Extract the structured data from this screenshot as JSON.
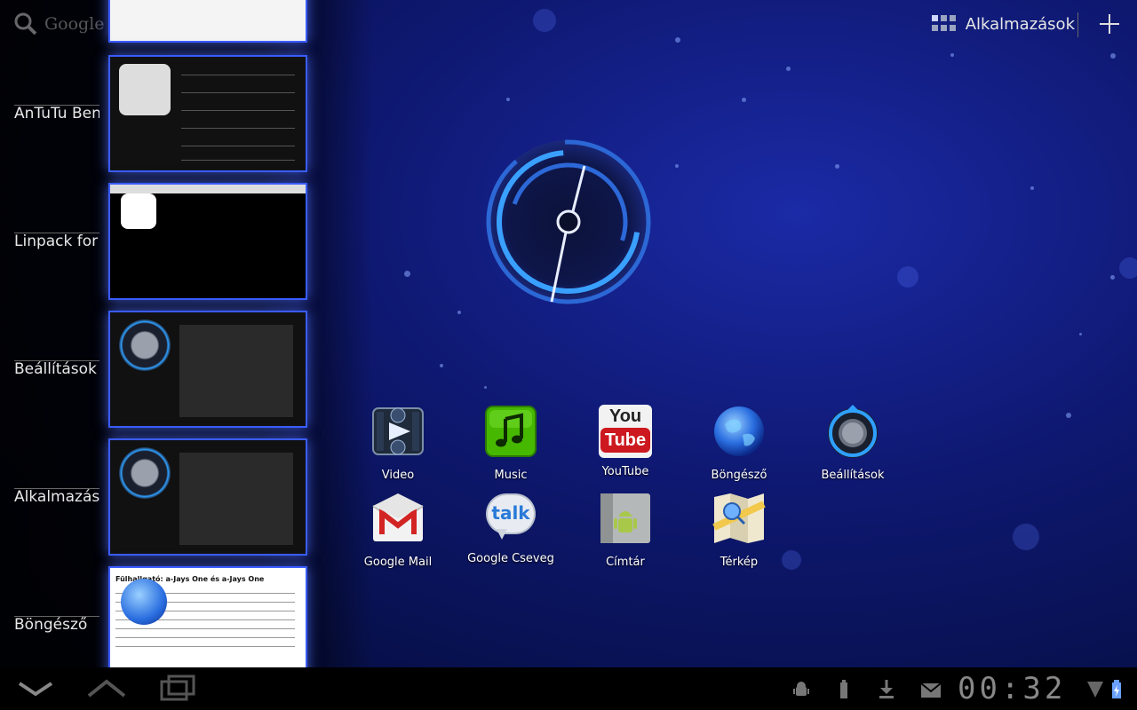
{
  "search": {
    "text": "Google"
  },
  "header": {
    "apps_label": "Alkalmazások"
  },
  "recents": [
    {
      "label": "AnTuTu Ben"
    },
    {
      "label": "Linpack for"
    },
    {
      "label": "Beállítások"
    },
    {
      "label": "Alkalmazást"
    },
    {
      "label": "Böngésző"
    }
  ],
  "browser_thumb": {
    "text": "Fülhallgató: a-Jays One és a-Jays One"
  },
  "apps": [
    {
      "label": "Video",
      "icon": "video-icon"
    },
    {
      "label": "Music",
      "icon": "music-icon"
    },
    {
      "label": "YouTube",
      "icon": "youtube-icon"
    },
    {
      "label": "Böngésző",
      "icon": "browser-globe-icon"
    },
    {
      "label": "Beállítások",
      "icon": "settings-icon"
    },
    {
      "label": "Google Mail",
      "icon": "gmail-icon"
    },
    {
      "label": "Google Cseveg",
      "icon": "talk-icon"
    },
    {
      "label": "Címtár",
      "icon": "contacts-icon"
    },
    {
      "label": "Térkép",
      "icon": "maps-icon"
    }
  ],
  "youtube_icon_text": {
    "top": "You",
    "bottom": "Tube"
  },
  "talk_icon_text": "talk",
  "statusbar": {
    "time": "00:32"
  },
  "colors": {
    "accent": "#3a5cff",
    "widget_blue": "#3aa0ff",
    "music_green": "#47b800",
    "youtube_red": "#cc181e"
  }
}
